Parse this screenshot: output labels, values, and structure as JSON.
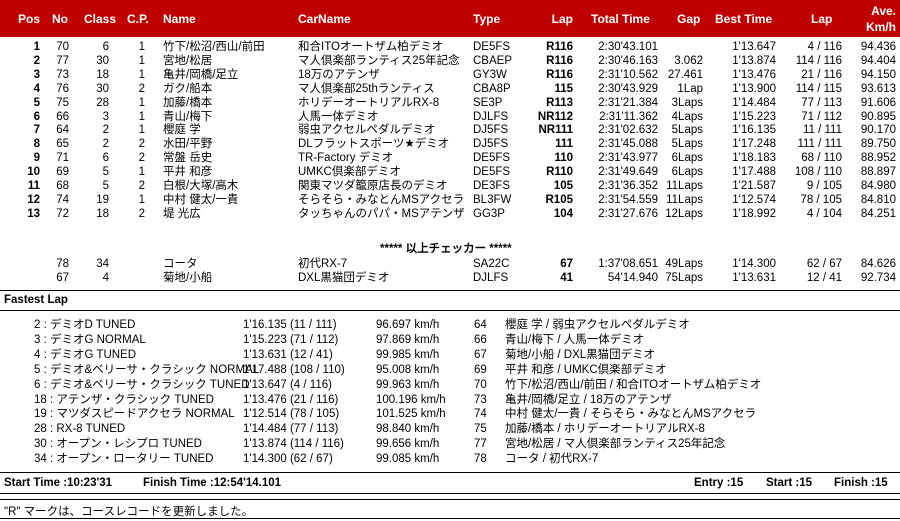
{
  "header": {
    "pos": "Pos",
    "no": "No",
    "class": "Class",
    "cp": "C.P.",
    "name": "Name",
    "carname": "CarName",
    "type": "Type",
    "lap": "Lap",
    "total_time": "Total Time",
    "gap": "Gap",
    "best_time": "Best Time",
    "lap2": "Lap",
    "ave1": "Ave.",
    "ave2": "Km/h"
  },
  "results": [
    {
      "pos": "1",
      "no": "70",
      "cls": "6",
      "cp": "1",
      "name": "竹下/松沼/西山/前田",
      "car": "和合ITOオートザム柏デミオ",
      "type": "DE5FS",
      "lap": "R116",
      "total": "2:30'43.101",
      "gap": "",
      "best": "1'13.647",
      "lap2": "4 / 116",
      "ave": "94.436"
    },
    {
      "pos": "2",
      "no": "77",
      "cls": "30",
      "cp": "1",
      "name": "宮地/松居",
      "car": "マ人倶楽部ランティス25年記念",
      "type": "CBAEP",
      "lap": "R116",
      "total": "2:30'46.163",
      "gap": "3.062",
      "best": "1'13.874",
      "lap2": "114 / 116",
      "ave": "94.404"
    },
    {
      "pos": "3",
      "no": "73",
      "cls": "18",
      "cp": "1",
      "name": "亀井/岡橋/足立",
      "car": "18万のアテンザ",
      "type": "GY3W",
      "lap": "R116",
      "total": "2:31'10.562",
      "gap": "27.461",
      "best": "1'13.476",
      "lap2": "21 / 116",
      "ave": "94.150"
    },
    {
      "pos": "4",
      "no": "76",
      "cls": "30",
      "cp": "2",
      "name": "ガク/船本",
      "car": "マ人倶楽部25thランティス",
      "type": "CBA8P",
      "lap": "115",
      "total": "2:30'43.929",
      "gap": "1Lap",
      "best": "1'13.900",
      "lap2": "114 / 115",
      "ave": "93.613"
    },
    {
      "pos": "5",
      "no": "75",
      "cls": "28",
      "cp": "1",
      "name": "加藤/橋本",
      "car": "ホリデーオートリアルRX-8",
      "type": "SE3P",
      "lap": "R113",
      "total": "2:31'21.384",
      "gap": "3Laps",
      "best": "1'14.484",
      "lap2": "77 / 113",
      "ave": "91.606"
    },
    {
      "pos": "6",
      "no": "66",
      "cls": "3",
      "cp": "1",
      "name": "青山/梅下",
      "car": "人馬一体デミオ",
      "type": "DJLFS",
      "lap": "NR112",
      "total": "2:31'11.362",
      "gap": "4Laps",
      "best": "1'15.223",
      "lap2": "71 / 112",
      "ave": "90.895"
    },
    {
      "pos": "7",
      "no": "64",
      "cls": "2",
      "cp": "1",
      "name": "櫻庭 学",
      "car": "弱虫アクセルペダルデミオ",
      "type": "DJ5FS",
      "lap": "NR111",
      "total": "2:31'02.632",
      "gap": "5Laps",
      "best": "1'16.135",
      "lap2": "11 / 111",
      "ave": "90.170"
    },
    {
      "pos": "8",
      "no": "65",
      "cls": "2",
      "cp": "2",
      "name": "水田/平野",
      "car": "DLフラットスポーツ★デミオ",
      "type": "DJ5FS",
      "lap": "111",
      "total": "2:31'45.088",
      "gap": "5Laps",
      "best": "1'17.248",
      "lap2": "111 / 111",
      "ave": "89.750"
    },
    {
      "pos": "9",
      "no": "71",
      "cls": "6",
      "cp": "2",
      "name": "常盤 岳史",
      "car": "TR-Factory デミオ",
      "type": "DE5FS",
      "lap": "110",
      "total": "2:31'43.977",
      "gap": "6Laps",
      "best": "1'18.183",
      "lap2": "68 / 110",
      "ave": "88.952"
    },
    {
      "pos": "10",
      "no": "69",
      "cls": "5",
      "cp": "1",
      "name": "平井 和彦",
      "car": "UMKC倶楽部デミオ",
      "type": "DE5FS",
      "lap": "R110",
      "total": "2:31'49.649",
      "gap": "6Laps",
      "best": "1'17.488",
      "lap2": "108 / 110",
      "ave": "88.897"
    },
    {
      "pos": "11",
      "no": "68",
      "cls": "5",
      "cp": "2",
      "name": "白根/大塚/高木",
      "car": "関東マツダ籠原店長のデミオ",
      "type": "DE3FS",
      "lap": "105",
      "total": "2:31'36.352",
      "gap": "11Laps",
      "best": "1'21.587",
      "lap2": "9 / 105",
      "ave": "84.980"
    },
    {
      "pos": "12",
      "no": "74",
      "cls": "19",
      "cp": "1",
      "name": "中村 健太/一貴",
      "car": "そらそら・みなとんMSアクセラ",
      "type": "BL3FW",
      "lap": "R105",
      "total": "2:31'54.559",
      "gap": "11Laps",
      "best": "1'12.574",
      "lap2": "78 / 105",
      "ave": "84.810"
    },
    {
      "pos": "13",
      "no": "72",
      "cls": "18",
      "cp": "2",
      "name": "堤 光広",
      "car": "タッちゃんのパパ・MSアテンザ",
      "type": "GG3P",
      "lap": "104",
      "total": "2:31'27.676",
      "gap": "12Laps",
      "best": "1'18.992",
      "lap2": "4 / 104",
      "ave": "84.251"
    }
  ],
  "checker_line": "***** 以上チェッカー *****",
  "unclassified": [
    {
      "pos": "",
      "no": "78",
      "cls": "34",
      "cp": "",
      "name": "コータ",
      "car": "初代RX-7",
      "type": "SA22C",
      "lap": "67",
      "total": "1:37'08.651",
      "gap": "49Laps",
      "best": "1'14.300",
      "lap2": "62 / 67",
      "ave": "84.626"
    },
    {
      "pos": "",
      "no": "67",
      "cls": "4",
      "cp": "",
      "name": "菊地/小船",
      "car": "DXL黒猫団デミオ",
      "type": "DJLFS",
      "lap": "41",
      "total": "54'14.940",
      "gap": "75Laps",
      "best": "1'13.631",
      "lap2": "12 / 41",
      "ave": "92.734"
    }
  ],
  "fastest_lap_title": "Fastest Lap",
  "fastest_laps": [
    {
      "cls": "2 : デミオD TUNED",
      "time": "1'16.135 (11 / 111)",
      "speed": "96.697 km/h",
      "no": "64",
      "who": "櫻庭 学 / 弱虫アクセルペダルデミオ"
    },
    {
      "cls": "3 : デミオG NORMAL",
      "time": "1'15.223 (71 / 112)",
      "speed": "97.869 km/h",
      "no": "66",
      "who": "青山/梅下 / 人馬一体デミオ"
    },
    {
      "cls": "4 : デミオG TUNED",
      "time": "1'13.631 (12 / 41)",
      "speed": "99.985 km/h",
      "no": "67",
      "who": "菊地/小船 / DXL黒猫団デミオ"
    },
    {
      "cls": "5 : デミオ&ベリーサ・クラシック NORMAL",
      "time": "1'17.488 (108 / 110)",
      "speed": "95.008 km/h",
      "no": "69",
      "who": "平井 和彦 / UMKC倶楽部デミオ"
    },
    {
      "cls": "6 : デミオ&ベリーサ・クラシック TUNED",
      "time": "1'13.647 (4 / 116)",
      "speed": "99.963 km/h",
      "no": "70",
      "who": "竹下/松沼/西山/前田 / 和合ITOオートザム柏デミオ"
    },
    {
      "cls": "18 : アテンザ・クラシック TUNED",
      "time": "1'13.476 (21 / 116)",
      "speed": "100.196 km/h",
      "no": "73",
      "who": "亀井/岡橋/足立 / 18万のアテンザ"
    },
    {
      "cls": "19 : マツダスピードアクセラ NORMAL",
      "time": "1'12.514 (78 / 105)",
      "speed": "101.525 km/h",
      "no": "74",
      "who": "中村 健太/一貴 / そらそら・みなとんMSアクセラ"
    },
    {
      "cls": "28 : RX-8 TUNED",
      "time": "1'14.484 (77 / 113)",
      "speed": "98.840 km/h",
      "no": "75",
      "who": "加藤/橋本 / ホリデーオートリアルRX-8"
    },
    {
      "cls": "30 : オープン・レシプロ TUNED",
      "time": "1'13.874 (114 / 116)",
      "speed": "99.656 km/h",
      "no": "77",
      "who": "宮地/松居 / マ人倶楽部ランティス25年記念"
    },
    {
      "cls": "34 : オープン・ロータリー TUNED",
      "time": "1'14.300 (62 / 67)",
      "speed": "99.085 km/h",
      "no": "78",
      "who": "コータ / 初代RX-7"
    }
  ],
  "footer": {
    "start_time": "Start Time :10:23'31",
    "finish_time": "Finish Time :12:54'14.101",
    "entry": "Entry :15",
    "start": "Start :15",
    "finish": "Finish :15"
  },
  "note": "\"R\" マークは、コースレコードを更新しました。",
  "colors": {
    "header_bg": "#c00000",
    "header_text": "#ffffff"
  }
}
